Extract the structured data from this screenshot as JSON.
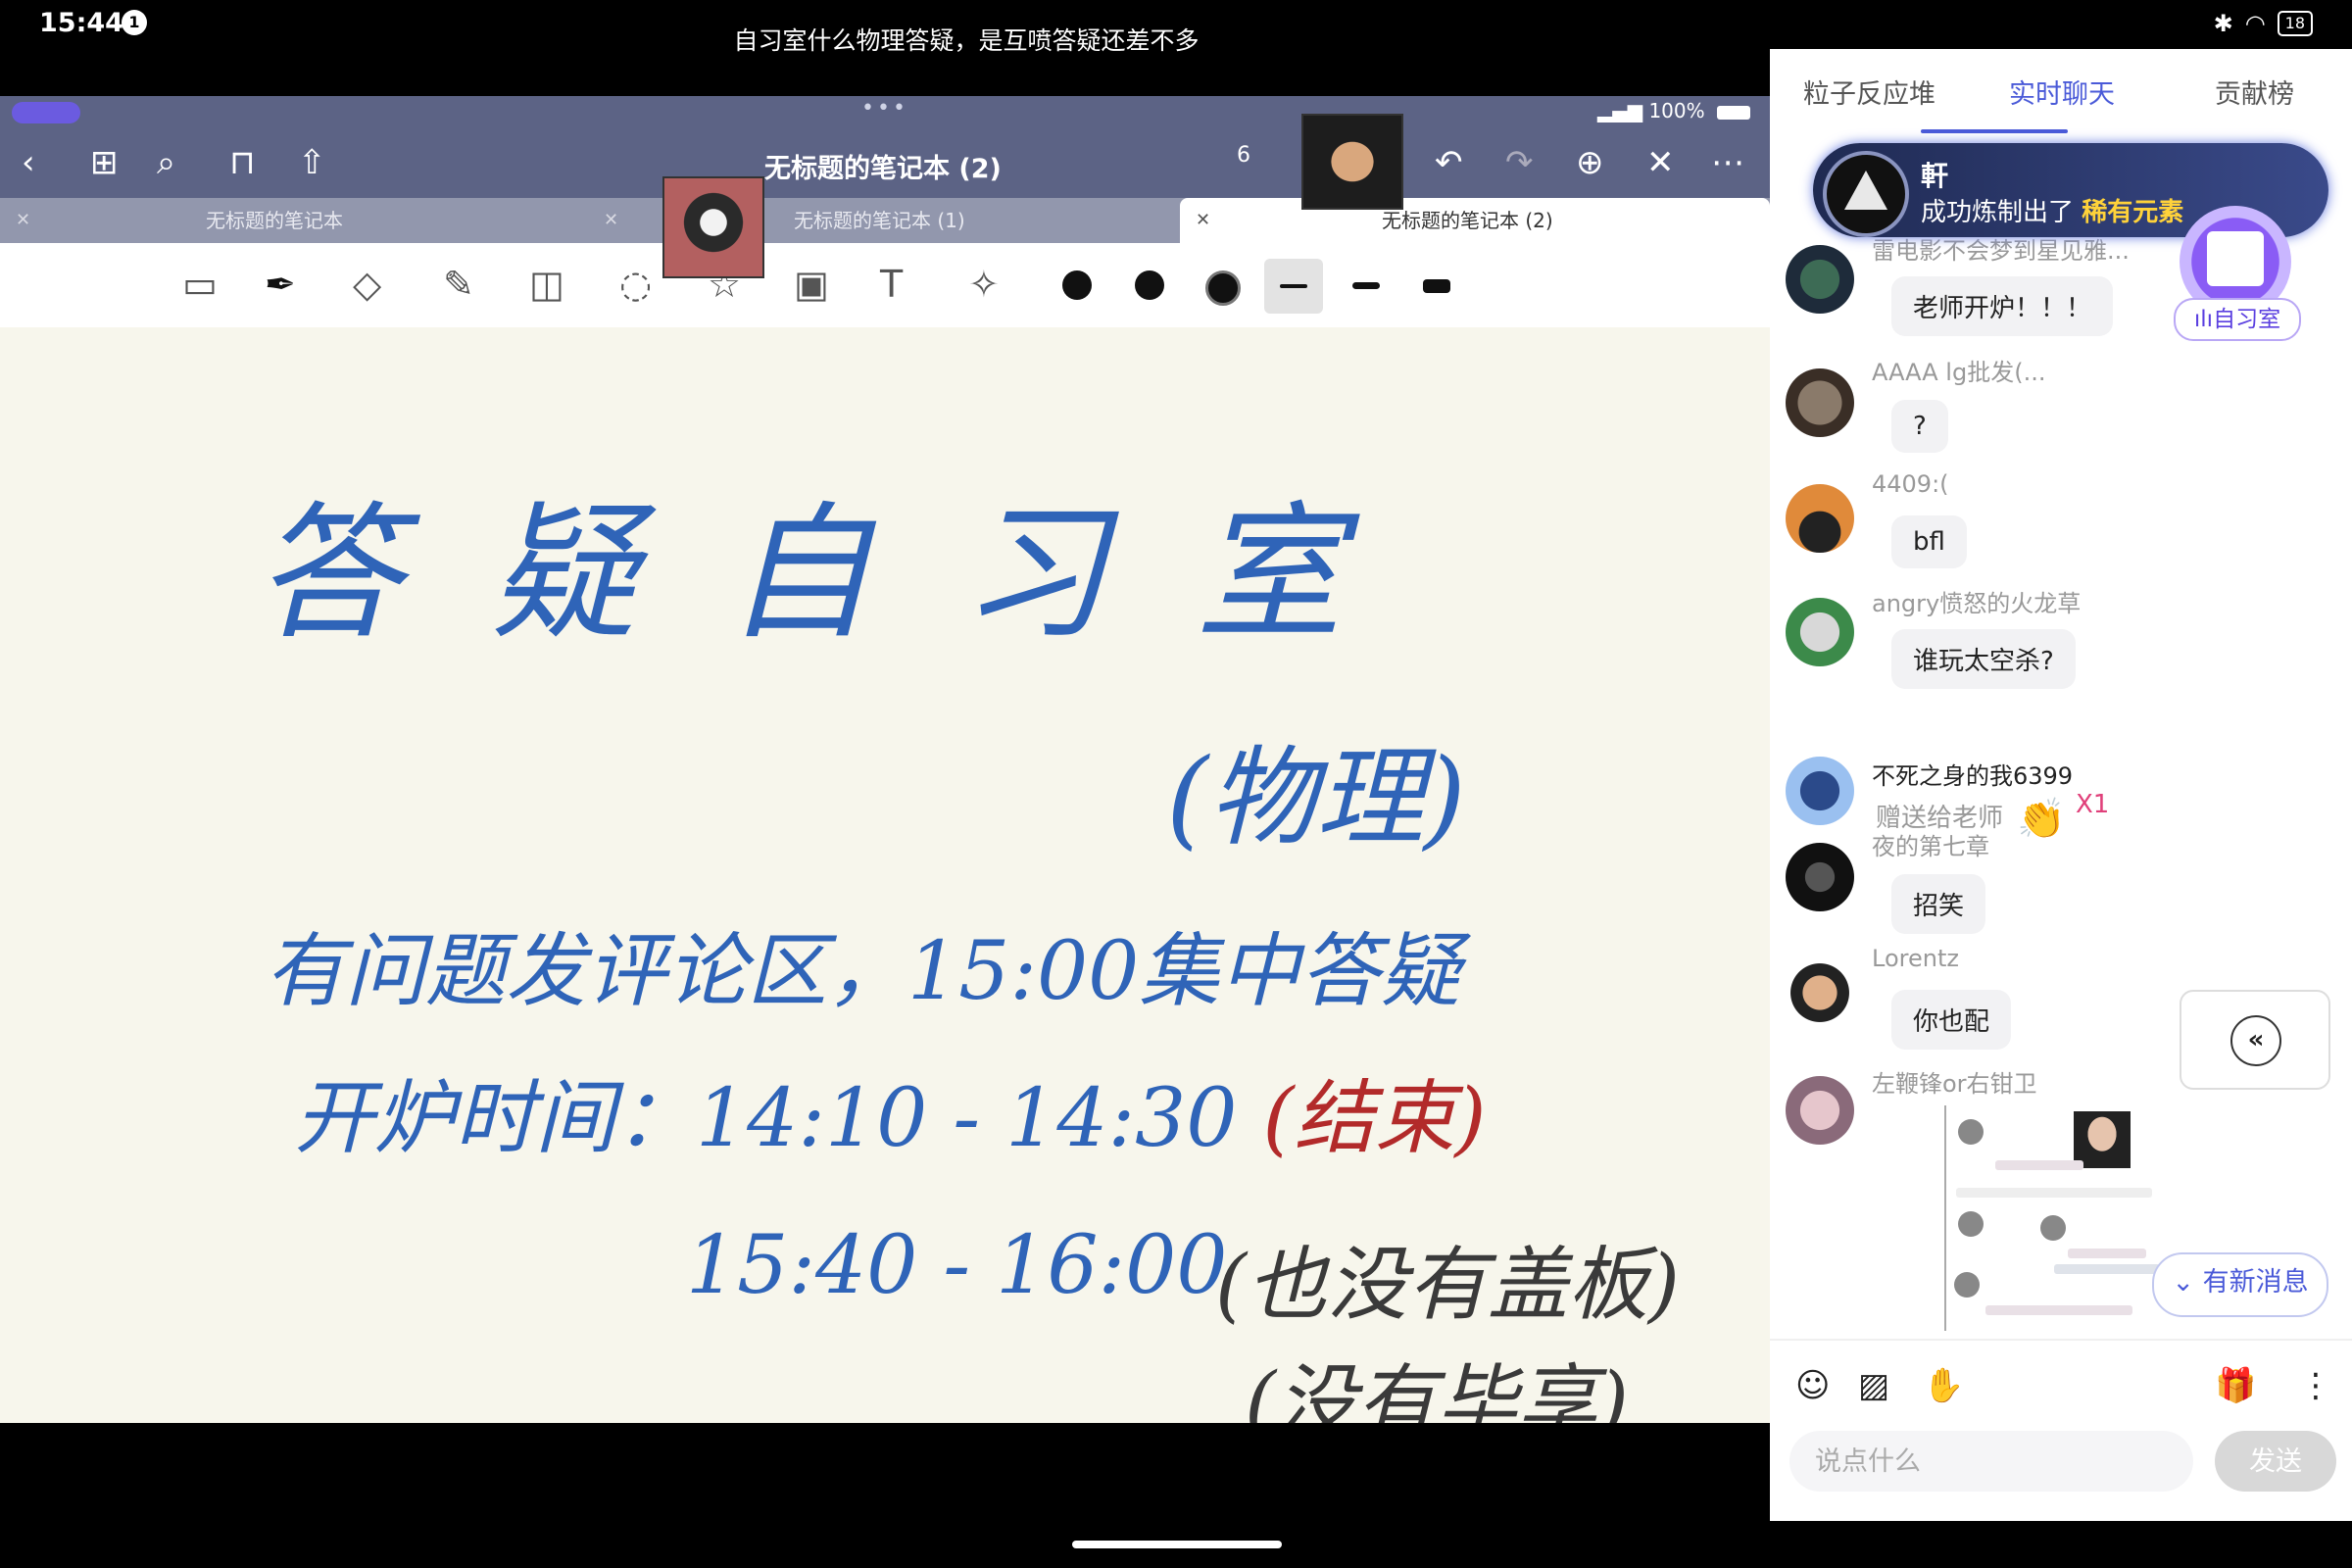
{
  "status_bar": {
    "time": "15:44",
    "notification_count": "1",
    "battery": "18"
  },
  "live_title": "自习室什么物理答疑，是互喷答疑还差不多",
  "stream": {
    "ipad_battery": "100%",
    "notebook_title": "无标题的笔记本 (2)",
    "page_number": "6",
    "tabs": [
      "无标题的笔记本",
      "无标题的笔记本 (1)",
      "无标题的笔记本 (2)"
    ],
    "whiteboard": {
      "title": "答疑自习室",
      "subtitle": "(物理)",
      "line1": "有问题发评论区，15:00集中答疑",
      "line2_prefix": "开炉时间：14:10 - 14:30",
      "line2_end": "(结束)",
      "line3_time": "15:40 - 16:00",
      "line3_note": "(也没有盖板)",
      "line4": "(没有毕享)"
    }
  },
  "chat": {
    "tabs": [
      "粒子反应堆",
      "实时聊天",
      "贡献榜"
    ],
    "active_tab": "实时聊天",
    "banner": {
      "name": "軒",
      "text_prefix": "成功炼制出了",
      "highlight": "稀有元素"
    },
    "room_label": "ılı自习室",
    "messages": [
      {
        "user": "雷电影不会梦到星见雅...",
        "text": "老师开炉！！！"
      },
      {
        "user": "AAAA lg批发(...",
        "text": "?"
      },
      {
        "user": "4409:(",
        "text": "bfl"
      },
      {
        "user": "angry愤怒的火龙草",
        "text": "谁玩太空杀?"
      },
      {
        "user": "不死之身的我6399",
        "gift_text": "赠送给老师",
        "gift_count": "X1"
      },
      {
        "user": "夜的第七章",
        "text": "招笑"
      },
      {
        "user": "Lorentz",
        "text": "你也配"
      },
      {
        "user": "左鞭锋or右钳卫"
      }
    ],
    "new_messages": "有新消息",
    "input_placeholder": "说点什么",
    "send_label": "发送"
  },
  "colors": {
    "accent": "#4a5ad8",
    "toolbar": "#5c6385",
    "ink_blue": "#2f64b8",
    "ink_red": "#b22a2a"
  }
}
